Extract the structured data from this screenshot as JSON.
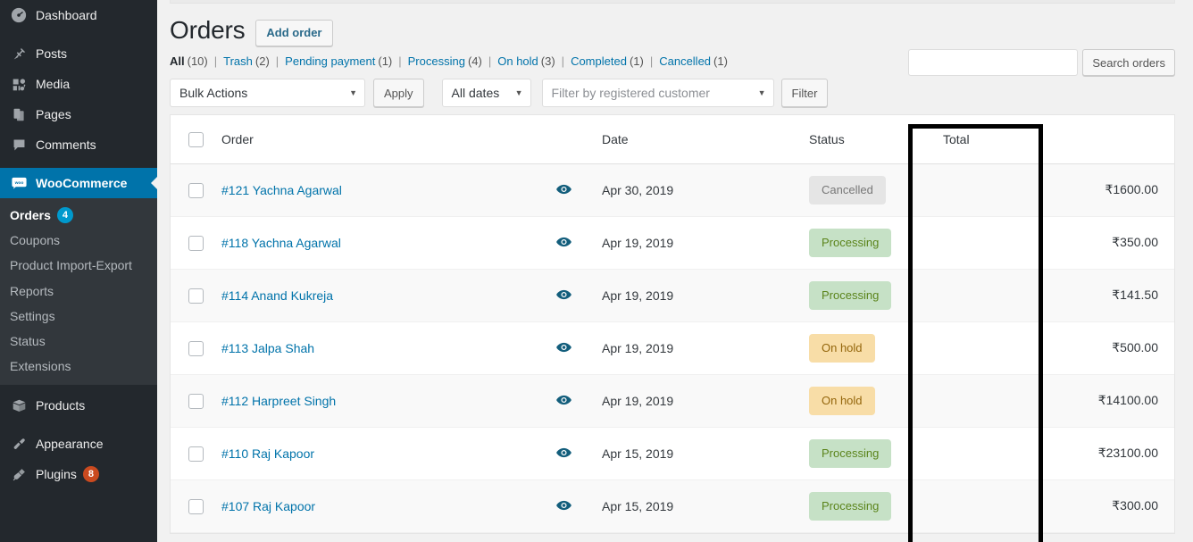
{
  "sidebar": {
    "items": [
      {
        "label": "Dashboard",
        "icon": "dashboard-icon",
        "active": false
      },
      {
        "label": "Posts",
        "icon": "pin-icon",
        "active": false
      },
      {
        "label": "Media",
        "icon": "media-icon",
        "active": false
      },
      {
        "label": "Pages",
        "icon": "pages-icon",
        "active": false
      },
      {
        "label": "Comments",
        "icon": "comments-icon",
        "active": false
      },
      {
        "label": "WooCommerce",
        "icon": "woocommerce-icon",
        "active": true
      },
      {
        "label": "Products",
        "icon": "products-box-icon",
        "active": false
      },
      {
        "label": "Appearance",
        "icon": "appearance-brush-icon",
        "active": false
      },
      {
        "label": "Plugins",
        "icon": "plugins-plug-icon",
        "active": false,
        "badge": "8"
      }
    ],
    "submenu": [
      {
        "label": "Orders",
        "badge": "4",
        "current": true
      },
      {
        "label": "Coupons",
        "current": false
      },
      {
        "label": "Product Import-Export",
        "current": false
      },
      {
        "label": "Reports",
        "current": false
      },
      {
        "label": "Settings",
        "current": false
      },
      {
        "label": "Status",
        "current": false
      },
      {
        "label": "Extensions",
        "current": false
      }
    ],
    "badge_colors": {
      "blue": "#0099cd",
      "orange": "#ca4a1f"
    }
  },
  "header": {
    "title": "Orders",
    "add_button": "Add order"
  },
  "status_filters": [
    {
      "label": "All",
      "count": "(10)",
      "current": true
    },
    {
      "label": "Trash",
      "count": "(2)",
      "current": false
    },
    {
      "label": "Pending payment",
      "count": "(1)",
      "current": false
    },
    {
      "label": "Processing",
      "count": "(4)",
      "current": false
    },
    {
      "label": "On hold",
      "count": "(3)",
      "current": false
    },
    {
      "label": "Completed",
      "count": "(1)",
      "current": false
    },
    {
      "label": "Cancelled",
      "count": "(1)",
      "current": false
    }
  ],
  "separator": "|",
  "toolbar": {
    "bulk_actions": "Bulk Actions",
    "apply": "Apply",
    "all_dates": "All dates",
    "customer_placeholder": "Filter by registered customer",
    "filter": "Filter",
    "caret": "▼"
  },
  "search": {
    "value": "",
    "placeholder": "",
    "button": "Search orders"
  },
  "table": {
    "columns": {
      "order": "Order",
      "date": "Date",
      "status": "Status",
      "total": "Total"
    },
    "rows": [
      {
        "order": "#121 Yachna Agarwal",
        "date": "Apr 30, 2019",
        "status": "Cancelled",
        "status_class": "st-cancelled",
        "total": "₹1600.00"
      },
      {
        "order": "#118 Yachna Agarwal",
        "date": "Apr 19, 2019",
        "status": "Processing",
        "status_class": "st-processing",
        "total": "₹350.00"
      },
      {
        "order": "#114 Anand Kukreja",
        "date": "Apr 19, 2019",
        "status": "Processing",
        "status_class": "st-processing",
        "total": "₹141.50"
      },
      {
        "order": "#113 Jalpa Shah",
        "date": "Apr 19, 2019",
        "status": "On hold",
        "status_class": "st-onhold",
        "total": "₹500.00"
      },
      {
        "order": "#112 Harpreet Singh",
        "date": "Apr 19, 2019",
        "status": "On hold",
        "status_class": "st-onhold",
        "total": "₹14100.00"
      },
      {
        "order": "#110 Raj Kapoor",
        "date": "Apr 15, 2019",
        "status": "Processing",
        "status_class": "st-processing",
        "total": "₹23100.00"
      },
      {
        "order": "#107 Raj Kapoor",
        "date": "Apr 15, 2019",
        "status": "Processing",
        "status_class": "st-processing",
        "total": "₹300.00"
      }
    ]
  },
  "annotation": {
    "highlight_target": "Status",
    "color": "#000000"
  },
  "colors": {
    "sidebar_bg": "#23282d",
    "submenu_bg": "#32373c",
    "accent_blue": "#0073aa",
    "status_processing_bg": "#c6e1c6",
    "status_onhold_bg": "#f8dda7",
    "status_cancelled_bg": "#e5e5e5"
  }
}
